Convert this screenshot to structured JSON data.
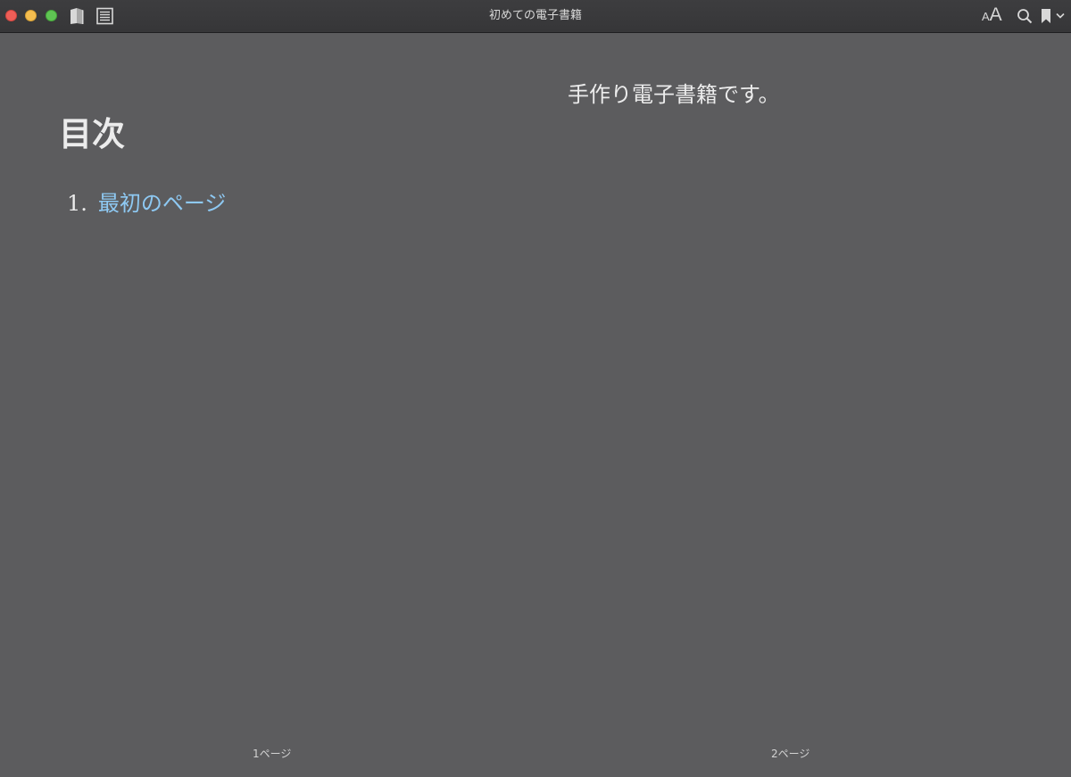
{
  "window": {
    "title": "初めての電子書籍"
  },
  "toolbar": {
    "font_size_small": "A",
    "font_size_large": "A"
  },
  "icons": {
    "library": "book-icon",
    "toc": "list-icon",
    "search": "search-icon",
    "bookmark": "bookmark-icon",
    "bookmark_menu": "chevron-down-icon"
  },
  "colors": {
    "page_background": "#5c5c5e",
    "link": "#8ec9f3",
    "text": "#ececec"
  },
  "left_page": {
    "heading": "目次",
    "toc_items": [
      {
        "number": "1.",
        "label": "最初のページ"
      }
    ],
    "page_label": "1ページ"
  },
  "right_page": {
    "body": "手作り電子書籍です。",
    "page_label": "2ページ"
  }
}
